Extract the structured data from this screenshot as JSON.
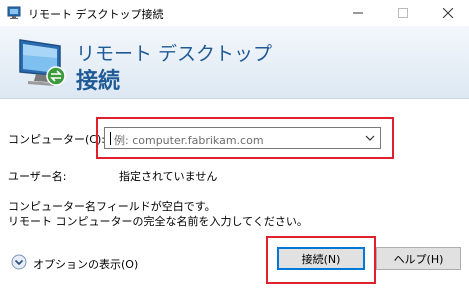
{
  "window": {
    "title": "リモート デスクトップ接続"
  },
  "banner": {
    "line1": "リモート デスクトップ",
    "line2": "接続"
  },
  "form": {
    "computer_label": "コンピューター(C):",
    "computer_placeholder": "例: computer.fabrikam.com",
    "username_label": "ユーザー名:",
    "username_value": "指定されていません",
    "message_line1": "コンピューター名フィールドが空白です。",
    "message_line2": "リモート コンピューターの完全な名前を入力してください。"
  },
  "footer": {
    "options_label": "オプションの表示(O)",
    "connect_label": "接続(N)",
    "help_label": "ヘルプ(H)"
  },
  "colors": {
    "accent": "#1f5a96",
    "highlight": "#e0202a"
  }
}
